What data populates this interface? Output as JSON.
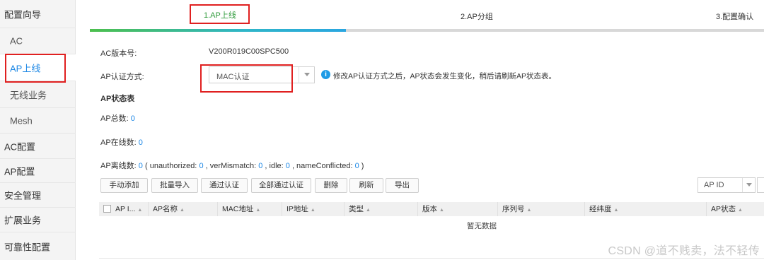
{
  "sidebar": {
    "items": [
      {
        "label": "配置向导"
      },
      {
        "label": "AC"
      },
      {
        "label": "AP上线"
      },
      {
        "label": "无线业务"
      },
      {
        "label": "Mesh"
      },
      {
        "label": "AC配置"
      },
      {
        "label": "AP配置"
      },
      {
        "label": "安全管理"
      },
      {
        "label": "扩展业务"
      },
      {
        "label": "可靠性配置"
      }
    ]
  },
  "steps": [
    {
      "label": "1.AP上线"
    },
    {
      "label": "2.AP分组"
    },
    {
      "label": "3.配置确认"
    }
  ],
  "progress": {
    "fraction": 0.38
  },
  "form": {
    "version_label": "AC版本号:",
    "version_value": "V200R019C00SPC500",
    "auth_label": "AP认证方式:",
    "auth_value": "MAC认证",
    "tip": "修改AP认证方式之后，AP状态会发生变化，稍后请刷新AP状态表。"
  },
  "status": {
    "title": "AP状态表",
    "total_label": "AP总数:",
    "total_value": "0",
    "online_label": "AP在线数:",
    "online_value": "0",
    "offline_label": "AP离线数:",
    "offline_value": "0",
    "unauthorized_label": "( unauthorized:",
    "unauthorized_value": "0",
    "vermismatch_label": ", verMismatch:",
    "vermismatch_value": "0",
    "idle_label": ", idle:",
    "idle_value": "0",
    "nameconflicted_label": ", nameConflicted:",
    "nameconflicted_value": "0",
    "close": ")"
  },
  "toolbar": {
    "buttons": [
      {
        "label": "手动添加"
      },
      {
        "label": "批量导入"
      },
      {
        "label": "通过认证"
      },
      {
        "label": "全部通过认证"
      },
      {
        "label": "删除"
      },
      {
        "label": "刷新"
      },
      {
        "label": "导出"
      }
    ],
    "filter_value": "AP ID"
  },
  "table": {
    "columns": [
      "AP I...",
      "AP名称",
      "MAC地址",
      "IP地址",
      "类型",
      "版本",
      "序列号",
      "经纬度",
      "AP状态"
    ],
    "empty_text": "暂无数据"
  },
  "watermark": "CSDN @道不贱卖，法不轻传",
  "colors": {
    "accent": "#1e88e5",
    "step_active": "#2e9a3a",
    "annotation": "#e02020"
  },
  "icons": {
    "info": "info-icon",
    "sort": "sort-icon",
    "dropdown": "chevron-down-icon"
  }
}
